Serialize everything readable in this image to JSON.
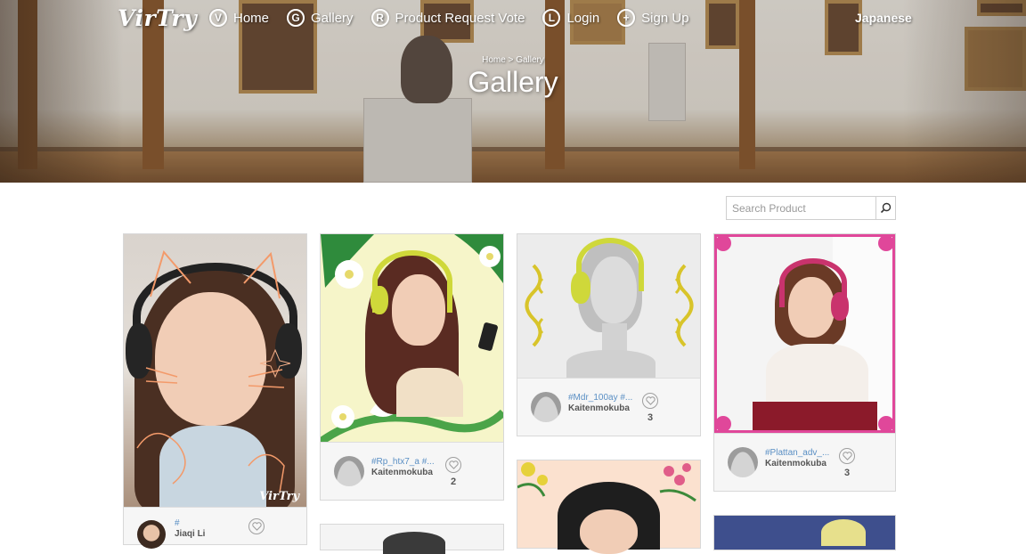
{
  "brand": "VirTry",
  "nav": {
    "items": [
      {
        "icon": "V",
        "icon_name": "v-circle-icon",
        "label": "Home"
      },
      {
        "icon": "G",
        "icon_name": "g-circle-icon",
        "label": "Gallery"
      },
      {
        "icon": "R",
        "icon_name": "r-circle-icon",
        "label": "Product Request Vote"
      },
      {
        "icon": "L",
        "icon_name": "l-circle-icon",
        "label": "Login"
      },
      {
        "icon": "+",
        "icon_name": "plus-circle-icon",
        "label": "Sign Up"
      }
    ],
    "language": "Japanese"
  },
  "breadcrumb": {
    "home": "Home",
    "separator": " > ",
    "current": "Gallery"
  },
  "page_title": "Gallery",
  "search": {
    "placeholder": "Search Product",
    "icon": "search-icon"
  },
  "cards": [
    {
      "tag": "#",
      "user": "Jiaqi Li",
      "count": "",
      "watermark": "VirTry"
    },
    {
      "tag": "#Rp_htx7_a #...",
      "user": "Kaitenmokuba",
      "count": "2"
    },
    {
      "tag": "#Mdr_100ay #...",
      "user": "Kaitenmokuba",
      "count": "3"
    },
    {
      "tag": "#Plattan_adv_...",
      "user": "Kaitenmokuba",
      "count": "3"
    }
  ],
  "colors": {
    "link": "#5a8fc4",
    "accent_pink": "#e0479a",
    "headphone_yellow": "#cfd83a"
  }
}
